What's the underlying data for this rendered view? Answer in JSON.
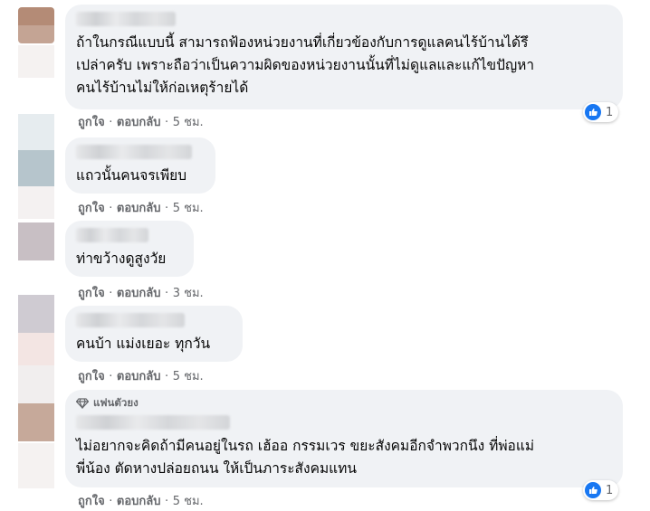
{
  "actions": {
    "like_label": "ถูกใจ",
    "reply_label": "ตอบกลับ",
    "separator": "·"
  },
  "comments": [
    {
      "text": "ถ้าในกรณีแบบนี้ สามารถฟ้องหน่วยงานที่เกี่ยวข้องกับการดูแลคนไร้บ้านได้รึ\nเปล่าครับ เพราะถือว่าเป็นความผิดของหน่วยงานนั้นที่ไม่ดูแลและแก้ไขปัญหา\nคนไร้บ้านไม่ให้ก่อเหตุร้ายได้",
      "time": "5 ชม.",
      "reaction_count": "1"
    },
    {
      "text": "แถวนั้นคนจรเพียบ",
      "time": "5 ชม."
    },
    {
      "text": "ท่าขว้างดูสูงวัย",
      "time": "3 ชม."
    },
    {
      "text": "คนบ้า แม่งเยอะ ทุกวัน",
      "time": "5 ชม."
    },
    {
      "badge": "แฟนตัวยง",
      "text": "ไม่อยากจะคิดถ้ามีคนอยู่ในรถ เฮ้ออ กรรมเวร ขยะสังคมอีกจำพวกนึง ที่พ่อแม่\nพี่น้อง ตัดหางปล่อยถนน ให้เป็นภาระสังคมแทน",
      "time": "5 ชม.",
      "reaction_count": "1"
    }
  ],
  "colors": {
    "bubble": "#f0f2f5",
    "meta_text": "#65676b",
    "like_blue": "#1877f2"
  },
  "icons": [
    "like-icon",
    "diamond-icon"
  ]
}
